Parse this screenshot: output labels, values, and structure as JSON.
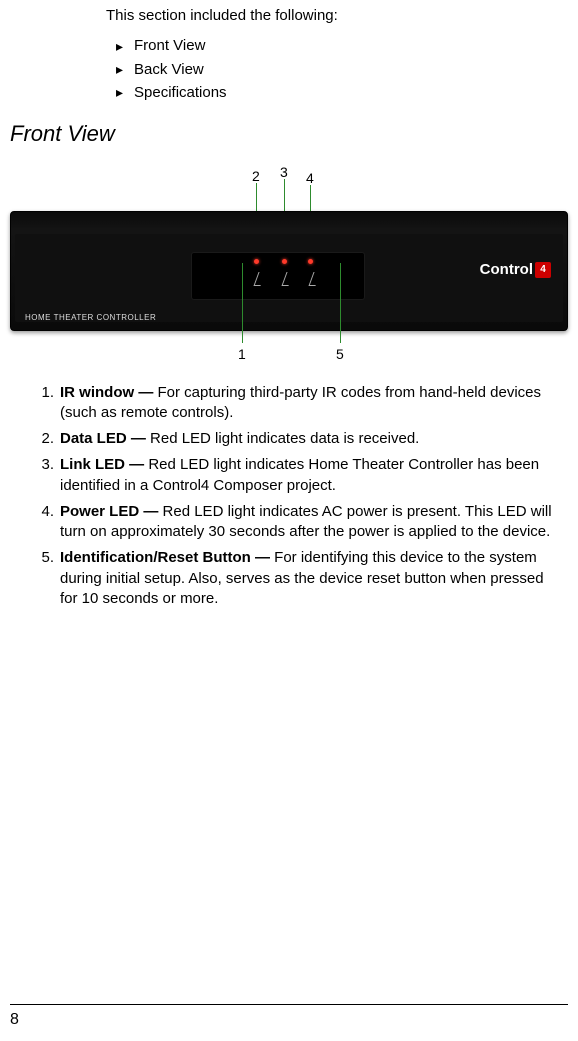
{
  "intro": "This section included the following:",
  "bullets": [
    "Front View",
    "Back View",
    "Specifications"
  ],
  "heading": "Front View",
  "callouts": {
    "n1": "1",
    "n2": "2",
    "n3": "3",
    "n4": "4",
    "n5": "5"
  },
  "device": {
    "label": "HOME THEATER CONTROLLER",
    "brand_text": "Control",
    "brand_badge": "4"
  },
  "descriptions": [
    {
      "num": "1.",
      "bold": "IR window — ",
      "rest": "For capturing third-party IR codes from hand-held devices (such as remote controls)."
    },
    {
      "num": "2.",
      "bold": "Data LED — ",
      "rest": "Red LED light indicates data is received."
    },
    {
      "num": "3.",
      "bold": "Link LED — ",
      "rest": "Red LED light indicates Home Theater Controller has been identified in a Control4 Composer project."
    },
    {
      "num": "4.",
      "bold": "Power LED — ",
      "rest": "Red LED light indicates AC power is present. This LED will turn on approximately 30 seconds after the power is applied to the device."
    },
    {
      "num": "5.",
      "bold": "Identification/Reset Button — ",
      "rest": "For identifying this device to the system during initial setup. Also, serves as the device reset button when pressed for 10 seconds or more."
    }
  ],
  "page_number": "8"
}
